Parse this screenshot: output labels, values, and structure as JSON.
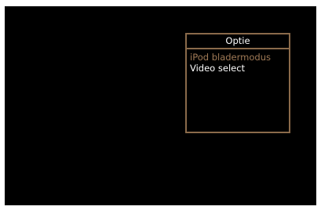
{
  "option_menu": {
    "title": "Optie",
    "items": [
      {
        "label": "iPod bladermodus",
        "state": "highlighted"
      },
      {
        "label": "Video select",
        "state": "normal"
      }
    ]
  },
  "colors": {
    "screen_background": "#000000",
    "border": "#8a6a4a",
    "highlight_text": "#a07a56",
    "normal_text": "#ffffff"
  }
}
